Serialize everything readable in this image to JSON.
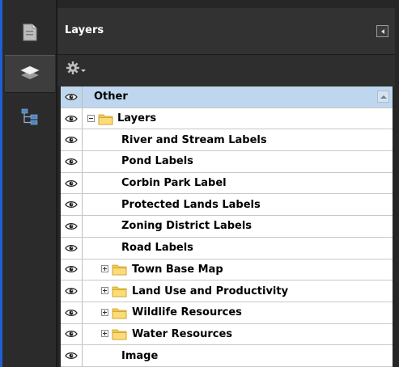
{
  "panel": {
    "title": "Layers"
  },
  "rail": {
    "buttons": [
      {
        "icon": "page-thumbnails-icon"
      },
      {
        "icon": "layers-icon",
        "active": true
      },
      {
        "icon": "model-tree-icon"
      }
    ]
  },
  "toolbar": {
    "options_icon": "gear-icon"
  },
  "tree": {
    "rows": [
      {
        "label": "Other",
        "level": 0,
        "selected": true
      },
      {
        "label": "Layers",
        "level": 0,
        "expander": "minus",
        "folder": true
      },
      {
        "label": "River and Stream Labels",
        "level": 1
      },
      {
        "label": "Pond Labels",
        "level": 1
      },
      {
        "label": "Corbin Park Label",
        "level": 1
      },
      {
        "label": "Protected Lands Labels",
        "level": 1
      },
      {
        "label": "Zoning District Labels",
        "level": 1
      },
      {
        "label": "Road Labels",
        "level": 1
      },
      {
        "label": "Town Base Map",
        "level": 1,
        "expander": "plus",
        "folder": true
      },
      {
        "label": "Land Use and Productivity",
        "level": 1,
        "expander": "plus",
        "folder": true
      },
      {
        "label": "Wildlife Resources",
        "level": 1,
        "expander": "plus",
        "folder": true
      },
      {
        "label": "Water Resources",
        "level": 1,
        "expander": "plus",
        "folder": true
      },
      {
        "label": "Image",
        "level": 1
      }
    ]
  }
}
